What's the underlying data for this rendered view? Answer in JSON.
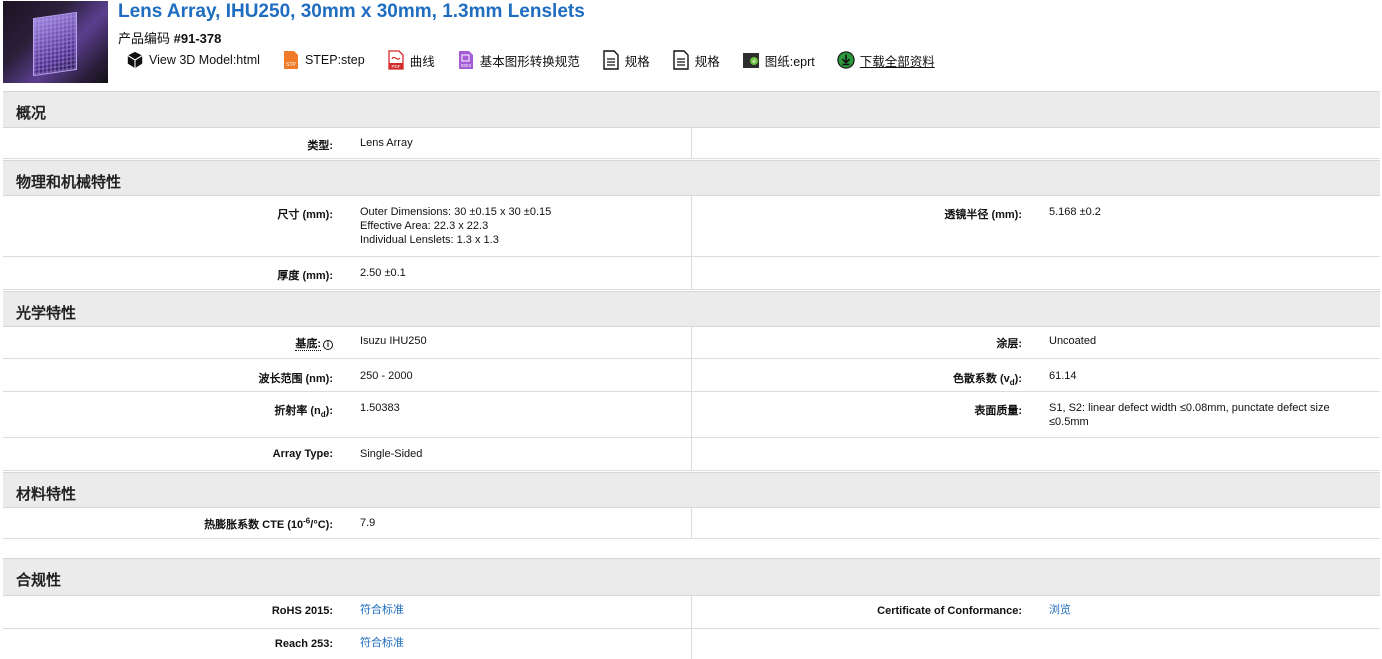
{
  "product": {
    "title": "Lens Array, IHU250, 30mm x 30mm, 1.3mm Lenslets",
    "code_label": "产品编码",
    "code_value": "#91-378"
  },
  "downloads": [
    {
      "label": "View 3D Model:html",
      "icon": "cube-icon"
    },
    {
      "label": "STEP:step",
      "icon": "step-file-icon"
    },
    {
      "label": "曲线",
      "icon": "pdf-file-icon"
    },
    {
      "label": "基本图形转换规范",
      "icon": "iges-file-icon"
    },
    {
      "label": "规格",
      "icon": "document-icon"
    },
    {
      "label": "规格",
      "icon": "document-icon"
    },
    {
      "label": "图纸:eprt",
      "icon": "eprt-file-icon"
    },
    {
      "label": "下载全部资料",
      "icon": "download-all-icon"
    }
  ],
  "sections": {
    "overview": "概况",
    "physical": "物理和机械特性",
    "optical": "光学特性",
    "material": "材料特性",
    "compliance": "合规性"
  },
  "specs": {
    "type_label": "类型:",
    "type_value": "Lens Array",
    "dimensions_label": "尺寸 (mm):",
    "dimensions_value_1": "Outer Dimensions: 30 ±0.15 x 30 ±0.15",
    "dimensions_value_2": "Effective Area: 22.3 x 22.3",
    "dimensions_value_3": "Individual Lenslets: 1.3 x 1.3",
    "radius_label": "透镜半径 (mm):",
    "radius_value": "5.168 ±0.2",
    "thickness_label": "厚度 (mm):",
    "thickness_value": "2.50 ±0.1",
    "substrate_label": "基底:",
    "substrate_value": "Isuzu IHU250",
    "coating_label": "涂层:",
    "coating_value": "Uncoated",
    "wavelength_label": "波长范围 (nm):",
    "wavelength_value": "250 - 2000",
    "abbe_label_prefix": "色散系数 (v",
    "abbe_label_sub": "d",
    "abbe_label_suffix": "):",
    "abbe_value": "61.14",
    "index_label_prefix": "折射率 (n",
    "index_label_sub": "d",
    "index_label_suffix": "):",
    "index_value": "1.50383",
    "surface_label": "表面质量:",
    "surface_value": "S1, S2: linear defect width ≤0.08mm, punctate defect size ≤0.5mm",
    "array_label": "Array Type:",
    "array_value": "Single-Sided",
    "cte_label_prefix": "热膨胀系数 CTE (10",
    "cte_label_sup": "-6",
    "cte_label_suffix": "/°C):",
    "cte_value": "7.9",
    "rohs_label": "RoHS 2015:",
    "rohs_value": "符合标准",
    "coc_label": "Certificate of Conformance:",
    "coc_value": "浏览",
    "reach_label": "Reach 253:",
    "reach_value": "符合标准"
  }
}
